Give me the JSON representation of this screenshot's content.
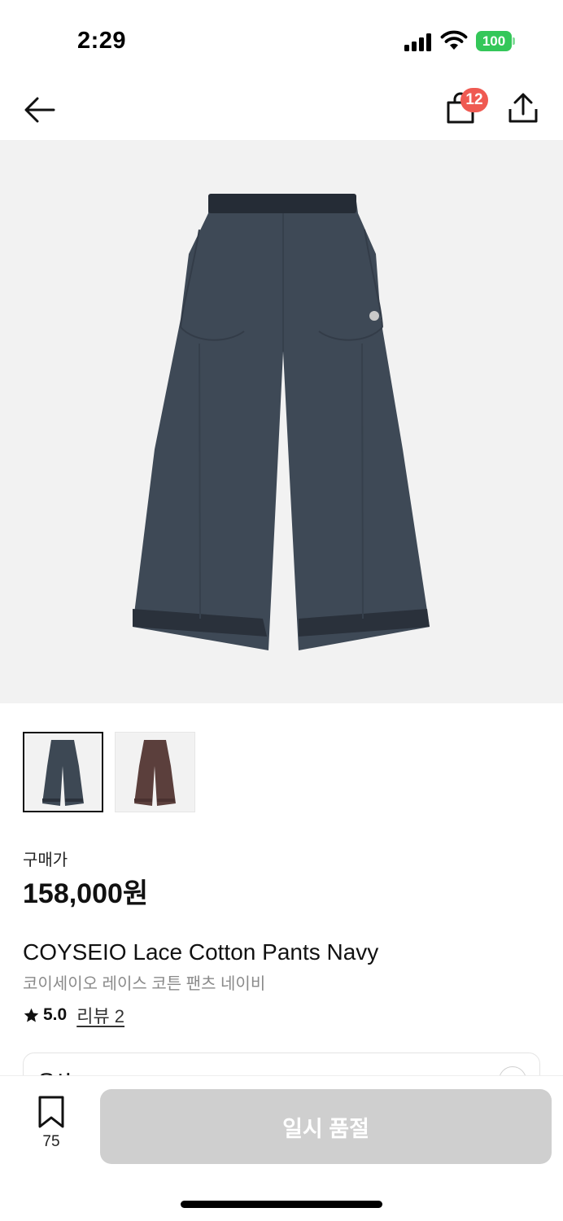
{
  "status_bar": {
    "time": "2:29",
    "battery": "100",
    "battery_color": "#34c759"
  },
  "nav": {
    "back_icon": "arrow-left-icon",
    "bag_icon": "shopping-bag-icon",
    "bag_count": "12",
    "badge_color": "#ef5a52",
    "share_icon": "share-icon"
  },
  "gallery": {
    "images": [
      {
        "name": "navy-pants",
        "color": "#3d4854",
        "selected": true
      },
      {
        "name": "brown-pants",
        "color": "#5b3f3c",
        "selected": false
      }
    ]
  },
  "product": {
    "price_label": "구매가",
    "price": "158,000원",
    "name": "COYSEIO Lace Cotton Pants Navy",
    "name_kr": "코이세이오 레이스 코튼 팬츠 네이비",
    "rating": "5.0",
    "review_link": "리뷰 2"
  },
  "options": {
    "label": "옵션"
  },
  "bottom_bar": {
    "wish_icon": "bookmark-icon",
    "wish_count": "75",
    "cta_label": "일시 품절",
    "cta_color": "#cfcfcf"
  }
}
